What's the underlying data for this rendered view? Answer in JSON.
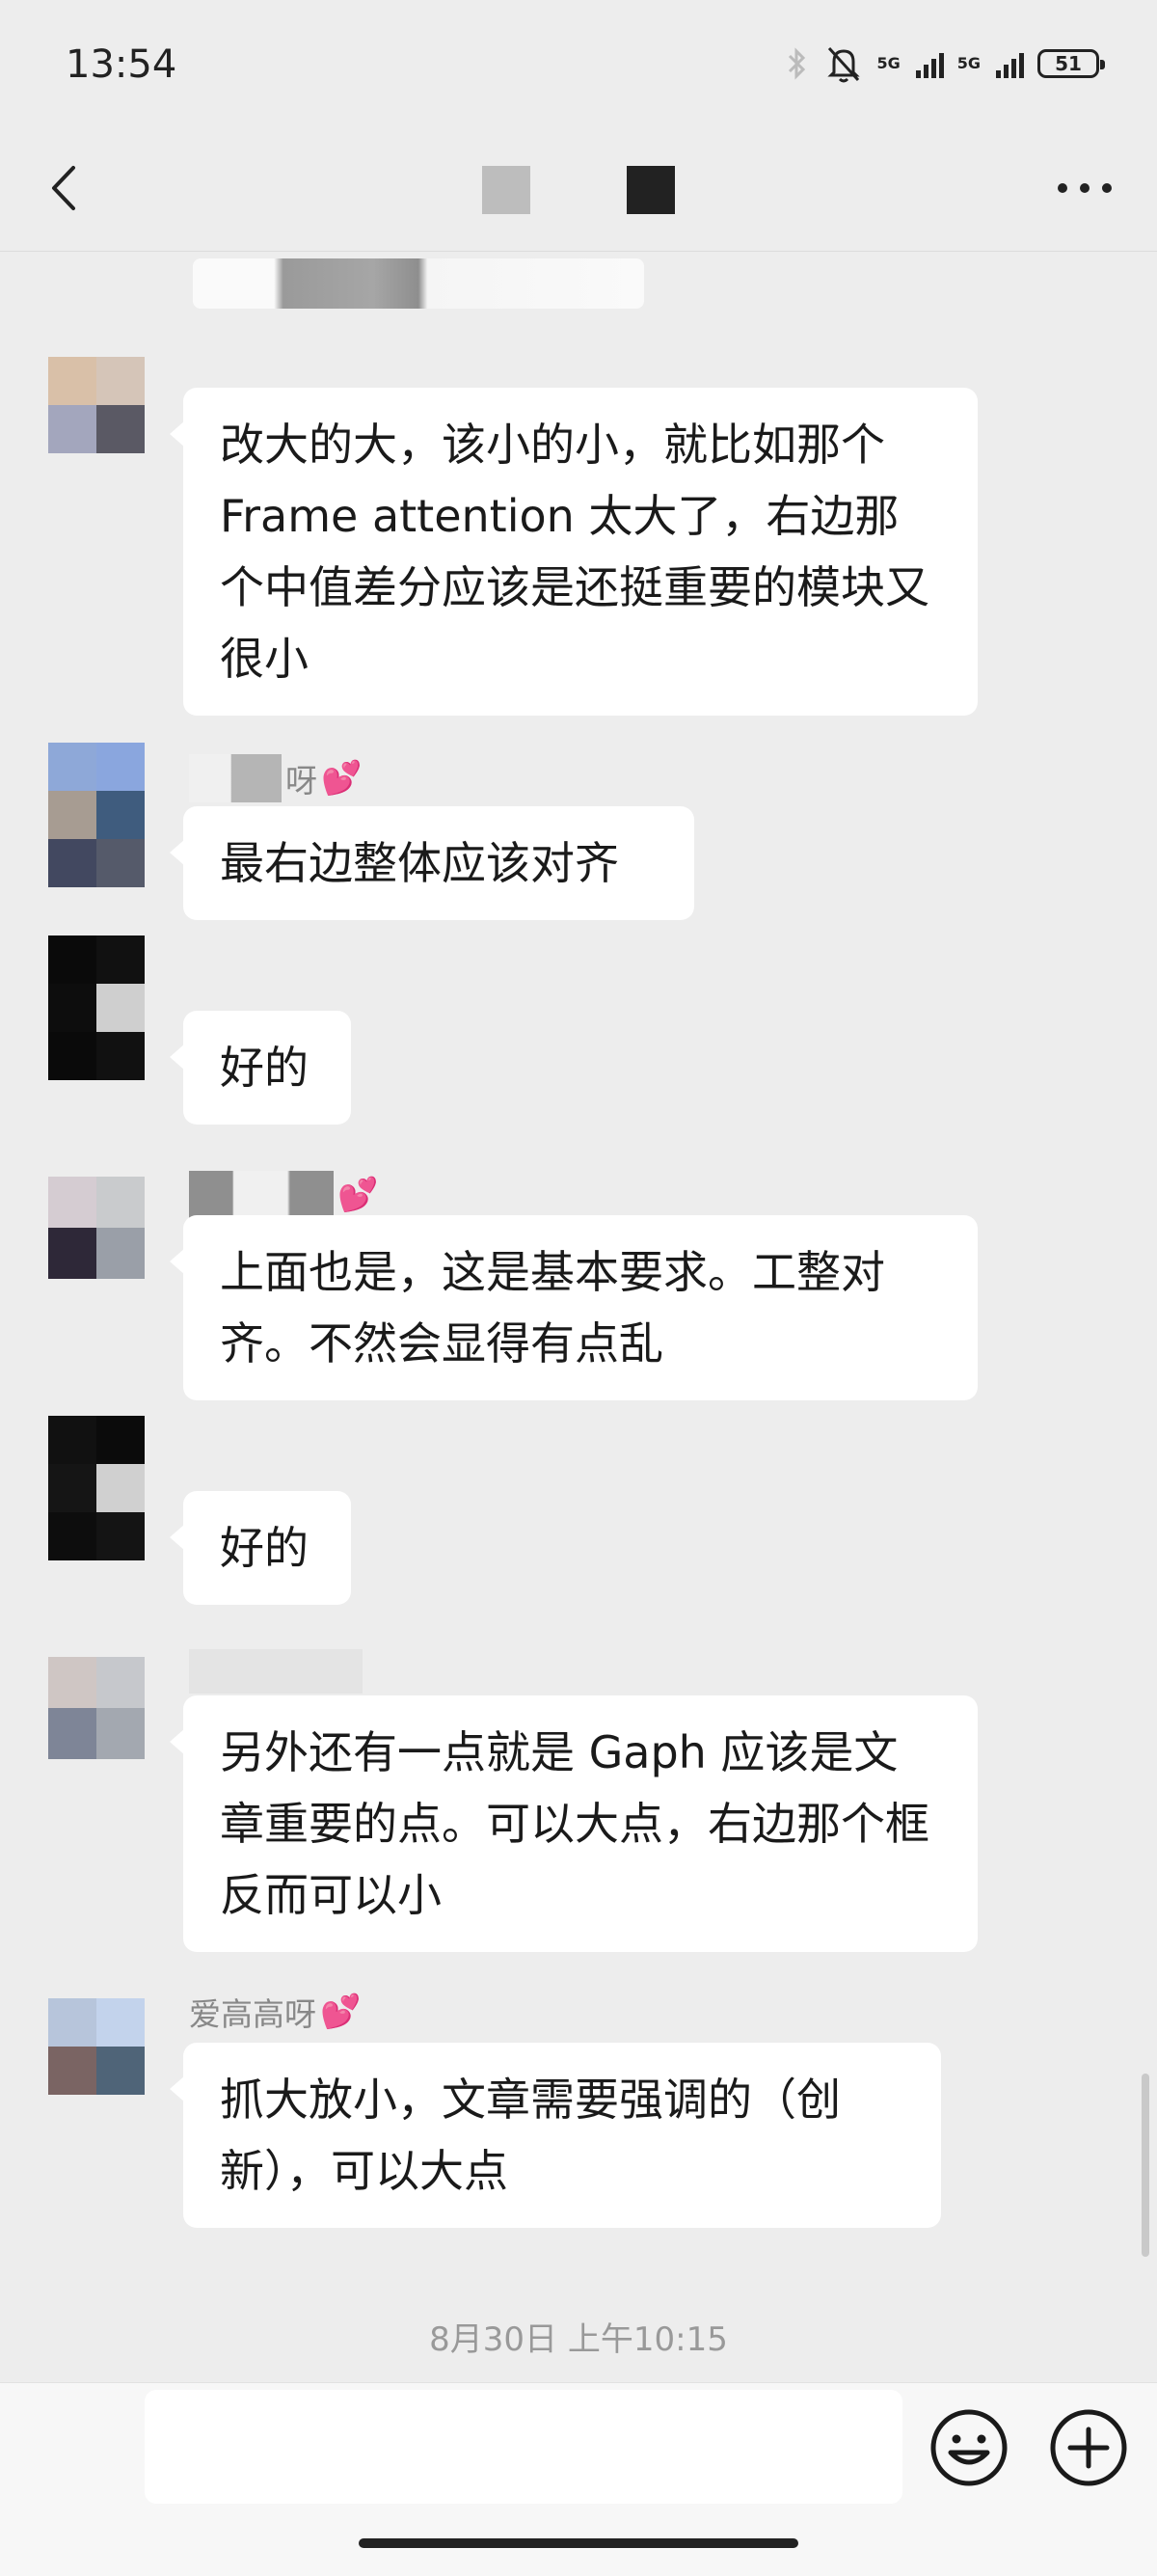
{
  "status_bar": {
    "time": "13:54",
    "network_1": "5G",
    "network_2": "5G",
    "battery_level": "51"
  },
  "header": {
    "more_label": "···"
  },
  "messages": [
    {
      "text": "改大的大，该小的小，就比如那个Frame attention 太大了，右边那个中值差分应该是还挺重要的模块又很小"
    },
    {
      "nickname_suffix": "呀",
      "text": "最右边整体应该对齐"
    },
    {
      "text": "好的"
    },
    {
      "text": "上面也是，这是基本要求。工整对齐。不然会显得有点乱"
    },
    {
      "text": "好的"
    },
    {
      "text": "另外还有一点就是 Gaph 应该是文章重要的点。可以大点，右边那个框反而可以小"
    },
    {
      "nickname": "爱高高呀",
      "text": "抓大放小，文章需要强调的（创新），可以大点"
    }
  ],
  "timestamp": "8月30日 上午10:15",
  "colors": {
    "background": "#ededed",
    "bubble": "#ffffff",
    "heart": "#e0578f"
  },
  "icons": {
    "heart": "💕"
  }
}
